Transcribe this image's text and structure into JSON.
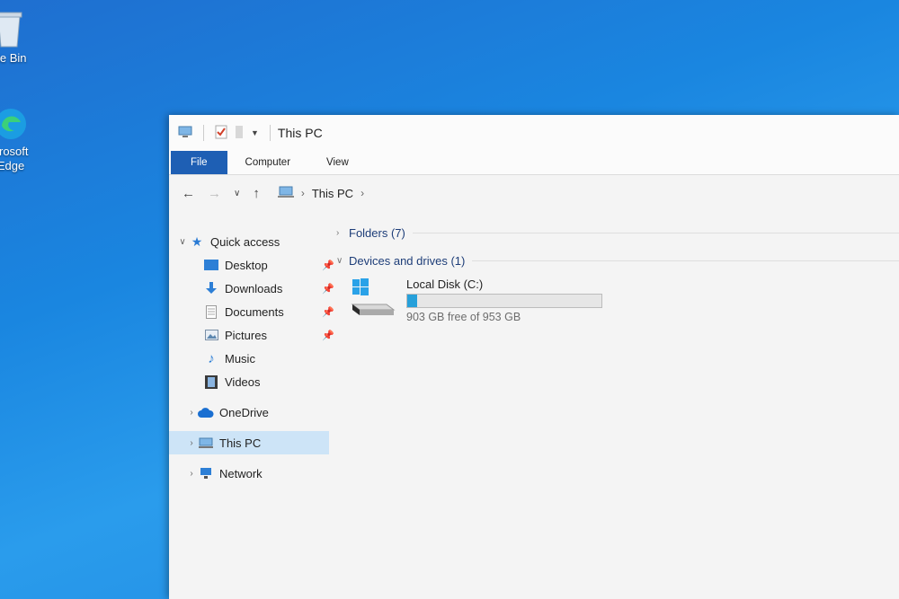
{
  "desktop": {
    "icons": [
      {
        "name": "recycle-bin",
        "label": "cle Bin"
      },
      {
        "name": "edge",
        "label_line1": "crosoft",
        "label_line2": "Edge"
      }
    ]
  },
  "window": {
    "title": "This PC",
    "ribbon_tabs": [
      "File",
      "Computer",
      "View"
    ],
    "breadcrumb": [
      "This PC"
    ],
    "nav": {
      "quick_access": "Quick access",
      "quick_items": [
        {
          "label": "Desktop",
          "icon": "desktop-icon",
          "pinned": true
        },
        {
          "label": "Downloads",
          "icon": "downloads-icon",
          "pinned": true
        },
        {
          "label": "Documents",
          "icon": "documents-icon",
          "pinned": true
        },
        {
          "label": "Pictures",
          "icon": "pictures-icon",
          "pinned": true
        },
        {
          "label": "Music",
          "icon": "music-icon",
          "pinned": false
        },
        {
          "label": "Videos",
          "icon": "videos-icon",
          "pinned": false
        }
      ],
      "onedrive": "OneDrive",
      "this_pc": "This PC",
      "network": "Network"
    },
    "content": {
      "folders_header": "Folders (7)",
      "devices_header": "Devices and drives (1)",
      "drive": {
        "name": "Local Disk (C:)",
        "free_text": "903 GB free of 953 GB",
        "used_fraction": 0.052
      }
    }
  },
  "colors": {
    "accent": "#1e5fb4",
    "selection": "#cde4f7",
    "drive_bar": "#26a0da",
    "group_header": "#1d3d78"
  }
}
